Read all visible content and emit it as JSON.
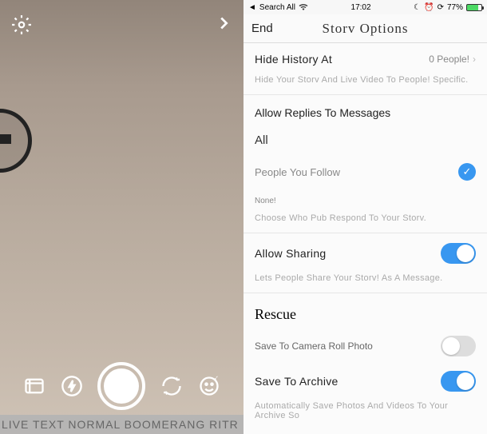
{
  "camera": {
    "mode_strip": "LIVE TEXT NORMAL BOOMERANG RITR"
  },
  "status": {
    "search": "Search All",
    "time": "17:02",
    "battery_pct": "77%"
  },
  "nav": {
    "end": "End",
    "title": "Storv Options"
  },
  "hide": {
    "label": "Hide History At",
    "value": "0 People!",
    "helper": "Hide Your Storv And Live Video To People! Specific."
  },
  "replies": {
    "section": "Allow Replies To Messages",
    "all": "All",
    "following": "People You Follow",
    "none": "None!",
    "helper": "Choose Who Pub Respond To Your Storv."
  },
  "sharing": {
    "label": "Allow Sharing",
    "helper": "Lets People Share Your Storv! As A Message."
  },
  "rescue": {
    "title": "Rescue",
    "camera_roll": "Save To Camera Roll Photo",
    "archive": "Save To Archive",
    "helper": "Automatically Save Photos And Videos To Your Archive So"
  }
}
